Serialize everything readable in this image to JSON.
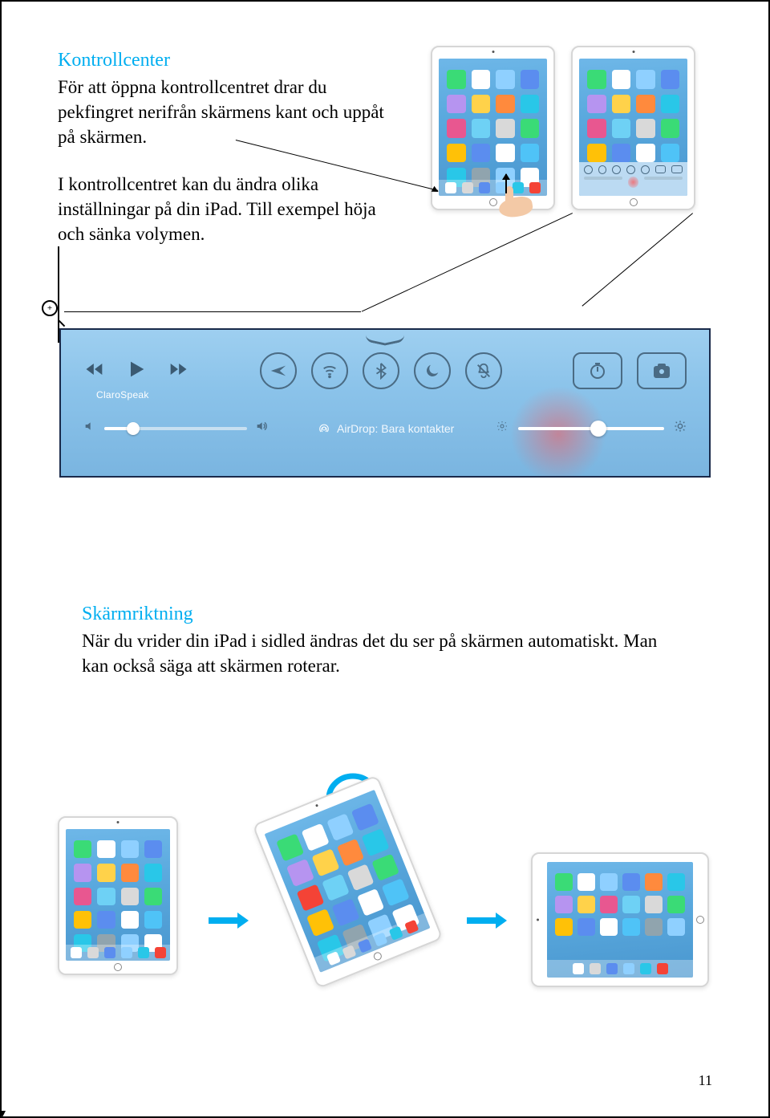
{
  "section1": {
    "heading": "Kontrollcenter",
    "para1": "För att öppna kontrollcentret drar du pekfingret nerifrån skärmens kant och uppåt på skärmen.",
    "para2": "I kontrollcentret kan du ändra olika inställningar på din iPad. Till exempel höja och sänka volymen."
  },
  "control_center": {
    "media_label": "ClaroSpeak",
    "airdrop_label": "AirDrop: Bara kontakter",
    "toggles": [
      "airplane",
      "wifi",
      "bluetooth",
      "do-not-disturb",
      "mute"
    ],
    "shortcuts": [
      "timer",
      "camera"
    ]
  },
  "section2": {
    "heading": "Skärmriktning",
    "para1": "När du vrider din iPad i sidled ändras det du ser på skärmen automatiskt. Man kan också säga att skärmen roterar."
  },
  "page_number": "11"
}
